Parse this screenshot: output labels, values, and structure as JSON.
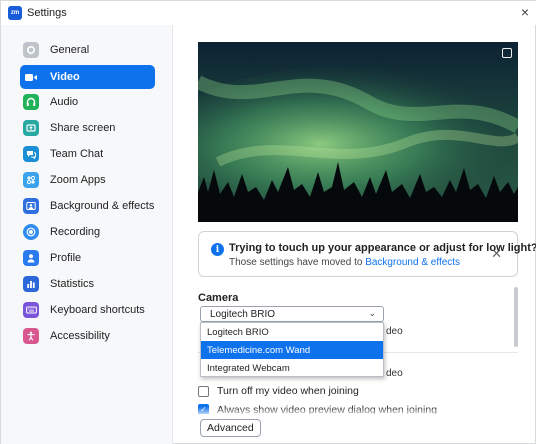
{
  "window": {
    "title": "Settings",
    "app_icon_text": "zm"
  },
  "sidebar": {
    "items": [
      {
        "label": "General",
        "icon": "gear-icon",
        "color": "#bfc4ca",
        "active": false
      },
      {
        "label": "Video",
        "icon": "video-camera-icon",
        "color": "#0e72ed",
        "active": true
      },
      {
        "label": "Audio",
        "icon": "headphones-icon",
        "color": "#22b35a",
        "active": false
      },
      {
        "label": "Share screen",
        "icon": "share-screen-icon",
        "color": "#27a8a3",
        "active": false
      },
      {
        "label": "Team Chat",
        "icon": "chat-bubble-icon",
        "color": "#1b8fd6",
        "active": false
      },
      {
        "label": "Zoom Apps",
        "icon": "apps-icon",
        "color": "#3aa3f0",
        "active": false
      },
      {
        "label": "Background & effects",
        "icon": "background-person-icon",
        "color": "#2f6fe0",
        "active": false
      },
      {
        "label": "Recording",
        "icon": "record-icon",
        "color": "#2f8cf0",
        "active": false
      },
      {
        "label": "Profile",
        "icon": "person-icon",
        "color": "#2a7bf0",
        "active": false
      },
      {
        "label": "Statistics",
        "icon": "bar-chart-icon",
        "color": "#2b67d9",
        "active": false
      },
      {
        "label": "Keyboard shortcuts",
        "icon": "keyboard-icon",
        "color": "#7b55d9",
        "active": false
      },
      {
        "label": "Accessibility",
        "icon": "accessibility-icon",
        "color": "#d9578f",
        "active": false
      }
    ]
  },
  "notice": {
    "title": "Trying to touch up your appearance or adjust for low light?",
    "text": "Those settings have moved to ",
    "link": "Background & effects"
  },
  "camera": {
    "label": "Camera",
    "selected": "Logitech BRIO",
    "options": [
      "Logitech BRIO",
      "Telemedicine.com Wand",
      "Integrated Webcam"
    ],
    "highlighted": "Telemedicine.com Wand"
  },
  "hidden_fragments": {
    "row1_tail": "deo",
    "row2_tail": "deo"
  },
  "options": {
    "turn_off_video": {
      "label": "Turn off my video when joining",
      "checked": false
    },
    "always_show_preview": {
      "label": "Always show video preview dialog when joining",
      "checked": true
    }
  },
  "advanced_label": "Advanced",
  "colors": {
    "accent": "#0e72ed"
  }
}
